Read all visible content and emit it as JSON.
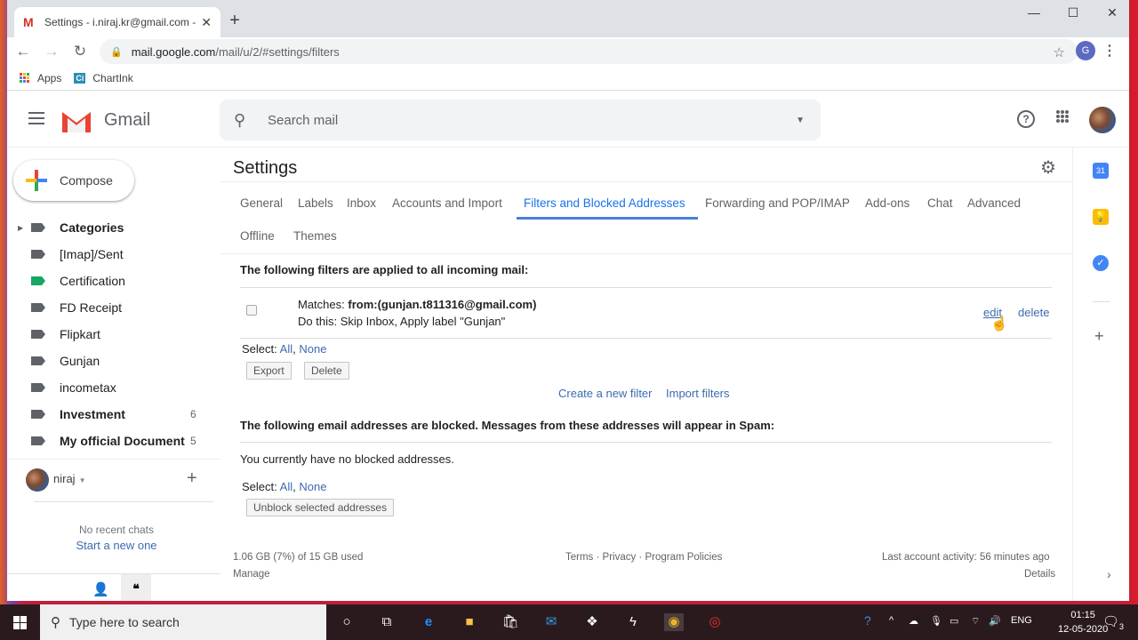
{
  "browser": {
    "tab_title": "Settings - i.niraj.kr@gmail.com -",
    "url_host": "mail.google.com",
    "url_path": "/mail/u/2/#settings/filters",
    "profile_initial": "G",
    "bookmarks": [
      {
        "label": "Apps",
        "icon": "apps-grid-icon"
      },
      {
        "label": "ChartInk",
        "icon": "chartink-icon",
        "icon_text": "Ci"
      }
    ]
  },
  "gmail": {
    "logo_text": "Gmail",
    "search_placeholder": "Search mail",
    "compose_label": "Compose"
  },
  "sidebar": {
    "labels": [
      {
        "name": "Categories",
        "bold": true,
        "expandable": true,
        "color": "#5f6368",
        "count": ""
      },
      {
        "name": "[Imap]/Sent",
        "bold": false,
        "color": "#5f6368",
        "count": ""
      },
      {
        "name": "Certification",
        "bold": false,
        "color": "#16a765",
        "count": ""
      },
      {
        "name": "FD Receipt",
        "bold": false,
        "color": "#5f6368",
        "count": ""
      },
      {
        "name": "Flipkart",
        "bold": false,
        "color": "#5f6368",
        "count": ""
      },
      {
        "name": "Gunjan",
        "bold": false,
        "color": "#5f6368",
        "count": ""
      },
      {
        "name": "incometax",
        "bold": false,
        "color": "#5f6368",
        "count": ""
      },
      {
        "name": "Investment",
        "bold": true,
        "color": "#5f6368",
        "count": "6"
      },
      {
        "name": "My official Document",
        "bold": true,
        "color": "#5f6368",
        "count": "5"
      }
    ],
    "hangouts": {
      "user": "niraj",
      "no_chats": "No recent chats",
      "start_new": "Start a new one"
    }
  },
  "settings": {
    "title": "Settings",
    "tabs": [
      {
        "label": "General",
        "active": false
      },
      {
        "label": "Labels",
        "active": false
      },
      {
        "label": "Inbox",
        "active": false
      },
      {
        "label": "Accounts and Import",
        "active": false
      },
      {
        "label": "Filters and Blocked Addresses",
        "active": true
      },
      {
        "label": "Forwarding and POP/IMAP",
        "active": false
      },
      {
        "label": "Add-ons",
        "active": false
      },
      {
        "label": "Chat",
        "active": false
      },
      {
        "label": "Advanced",
        "active": false
      },
      {
        "label": "Offline",
        "active": false
      },
      {
        "label": "Themes",
        "active": false
      }
    ],
    "filters_heading": "The following filters are applied to all incoming mail:",
    "filters": [
      {
        "matches_label": "Matches:",
        "matches_value": "from:(gunjan.t811316@gmail.com)",
        "action_label": "Do this:",
        "action_value": "Skip Inbox, Apply label \"Gunjan\"",
        "edit_label": "edit",
        "delete_label": "delete",
        "checked": false
      }
    ],
    "select_label": "Select:",
    "select_all": "All",
    "select_none": "None",
    "export_button": "Export",
    "delete_button": "Delete",
    "create_filter_link": "Create a new filter",
    "import_filters_link": "Import filters",
    "blocked_heading": "The following email addresses are blocked. Messages from these addresses will appear in Spam:",
    "no_blocked": "You currently have no blocked addresses.",
    "unblock_button": "Unblock selected addresses"
  },
  "footer": {
    "storage": "1.06 GB (7%) of 15 GB used",
    "manage": "Manage",
    "links": "Terms · Privacy · Program Policies",
    "activity": "Last account activity: 56 minutes ago",
    "details": "Details"
  },
  "side_panel": {
    "calendar_text": "31"
  },
  "taskbar": {
    "search_placeholder": "Type here to search",
    "language": "ENG",
    "time": "01:15",
    "date": "12-05-2020",
    "notification_count": "3"
  }
}
